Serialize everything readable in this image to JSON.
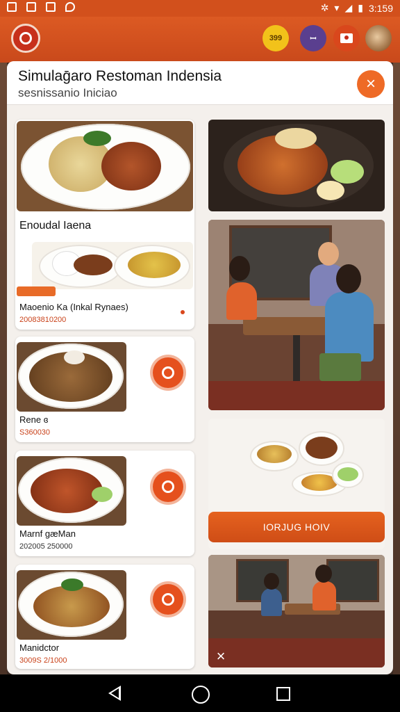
{
  "status_bar": {
    "time": "3:159"
  },
  "header": {
    "badges": [
      {
        "label": "399"
      },
      {
        "label": "ꟷ"
      }
    ],
    "icons": [
      "restaurant-logo-icon",
      "points-badge-icon",
      "bag-icon",
      "camera-icon",
      "avatar"
    ]
  },
  "panel": {
    "title": "Simulaḡaro Restoman Indensia",
    "subtitle": "sesnissanio Iniciao",
    "close_icon": "×"
  },
  "menu": {
    "section_title": "Enoudal Iaena",
    "featured": {
      "name": "Maoenio Ka (Inkal Rynaes)",
      "price": "20083810200",
      "tag": ""
    },
    "items": [
      {
        "name": "Rene ɞ",
        "price": "S360030"
      },
      {
        "name": "Marnf gæMan",
        "price": "202005 250000"
      },
      {
        "name": "Manidctor",
        "price": "3009S 2/1000"
      }
    ]
  },
  "cta": {
    "label": "IORJUG HOIV"
  },
  "scene_close": "×",
  "colors": {
    "accent": "#e05a20",
    "appbar": "#d2501c",
    "panel_bg": "#f4f0ec"
  }
}
